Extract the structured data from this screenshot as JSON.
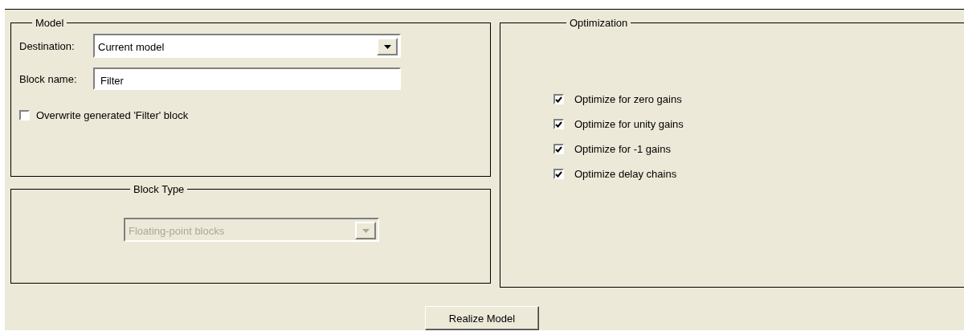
{
  "model": {
    "title": "Model",
    "destination": {
      "label": "Destination:",
      "value": "Current model"
    },
    "block_name": {
      "label": "Block name:",
      "value": "Filter"
    },
    "overwrite": {
      "label": "Overwrite generated 'Filter' block",
      "checked": false
    }
  },
  "block_type": {
    "title": "Block Type",
    "dropdown": {
      "value": "Floating-point blocks",
      "disabled": true
    }
  },
  "optimization": {
    "title": "Optimization",
    "options": [
      {
        "label": "Optimize for zero gains",
        "checked": true
      },
      {
        "label": "Optimize for unity gains",
        "checked": true
      },
      {
        "label": "Optimize for -1 gains",
        "checked": true
      },
      {
        "label": "Optimize delay chains",
        "checked": true
      }
    ]
  },
  "button": "Realize Model"
}
